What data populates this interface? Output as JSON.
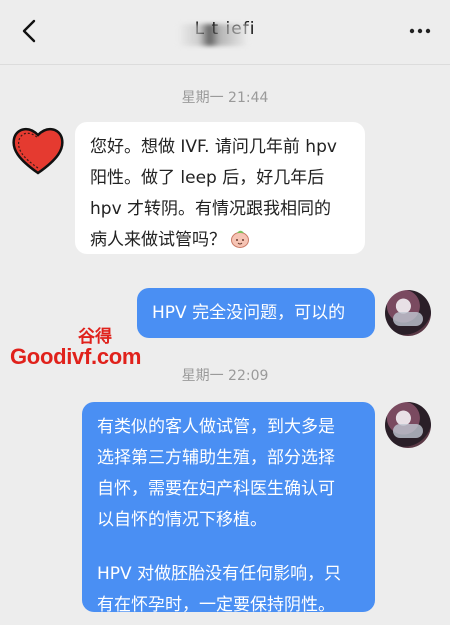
{
  "header": {
    "title": "L    t  iefi",
    "back_icon": "chevron-left-icon",
    "more_icon": "more-dots-icon"
  },
  "messages": [
    {
      "type": "timestamp",
      "text": "星期一 21:44"
    },
    {
      "type": "incoming",
      "lines": [
        "您好。想做 IVF. 请问几年前 hpv",
        "阳性。做了 leep 后，好几年后",
        "hpv 才转阴。有情况跟我相同的",
        "病人来做试管吗？"
      ],
      "emoji": "smiling-face-emoji"
    },
    {
      "type": "outgoing",
      "text": "HPV 完全没问题，可以的"
    },
    {
      "type": "timestamp",
      "text": "星期一 22:09"
    },
    {
      "type": "outgoing",
      "lines": [
        "有类似的客人做试管，到大多是",
        "选择第三方辅助生殖，部分选择",
        "自怀，需要在妇产科医生确认可",
        "以自怀的情况下移植。"
      ],
      "lines2": [
        "HPV 对做胚胎没有任何影响，只",
        "有在怀孕时，一定要保持阴性。"
      ]
    }
  ],
  "watermark": {
    "top": "谷得",
    "main": "Goodivf.com"
  },
  "colors": {
    "background": "#ededed",
    "outgoing_bubble": "#4a8ff3",
    "incoming_bubble": "#ffffff",
    "watermark": "#e0211b",
    "heart": "#e53a30"
  }
}
